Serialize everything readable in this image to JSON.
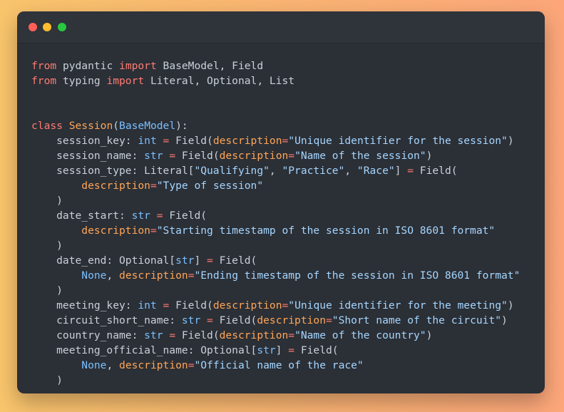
{
  "window": {
    "controls": [
      {
        "name": "close",
        "color": "#ff5f57"
      },
      {
        "name": "minimize",
        "color": "#febc2e"
      },
      {
        "name": "maximize",
        "color": "#28c840"
      }
    ]
  },
  "colors": {
    "keyword": "#ff7b72",
    "class_name": "#ffa657",
    "builtin": "#79c0ff",
    "string": "#a5d6ff",
    "argument": "#ffa657",
    "text": "#c9d1d9"
  },
  "code": {
    "lines": [
      [
        [
          "kw",
          "from"
        ],
        [
          "txt",
          " pydantic "
        ],
        [
          "kw",
          "import"
        ],
        [
          "txt",
          " BaseModel, Field"
        ]
      ],
      [
        [
          "kw",
          "from"
        ],
        [
          "txt",
          " typing "
        ],
        [
          "kw",
          "import"
        ],
        [
          "txt",
          " Literal, Optional, List"
        ]
      ],
      [],
      [],
      [
        [
          "kw",
          "class"
        ],
        [
          "txt",
          " "
        ],
        [
          "cls",
          "Session"
        ],
        [
          "txt",
          "("
        ],
        [
          "bi",
          "BaseModel"
        ],
        [
          "txt",
          "):"
        ]
      ],
      [
        [
          "txt",
          "    session_key: "
        ],
        [
          "bi",
          "int"
        ],
        [
          "txt",
          " "
        ],
        [
          "kw",
          "="
        ],
        [
          "txt",
          " Field("
        ],
        [
          "arg",
          "description"
        ],
        [
          "kw",
          "="
        ],
        [
          "str",
          "\"Unique identifier for the session\""
        ],
        [
          "txt",
          ")"
        ]
      ],
      [
        [
          "txt",
          "    session_name: "
        ],
        [
          "bi",
          "str"
        ],
        [
          "txt",
          " "
        ],
        [
          "kw",
          "="
        ],
        [
          "txt",
          " Field("
        ],
        [
          "arg",
          "description"
        ],
        [
          "kw",
          "="
        ],
        [
          "str",
          "\"Name of the session\""
        ],
        [
          "txt",
          ")"
        ]
      ],
      [
        [
          "txt",
          "    session_type: Literal["
        ],
        [
          "str",
          "\"Qualifying\""
        ],
        [
          "txt",
          ", "
        ],
        [
          "str",
          "\"Practice\""
        ],
        [
          "txt",
          ", "
        ],
        [
          "str",
          "\"Race\""
        ],
        [
          "txt",
          "] "
        ],
        [
          "kw",
          "="
        ],
        [
          "txt",
          " Field("
        ]
      ],
      [
        [
          "txt",
          "        "
        ],
        [
          "arg",
          "description"
        ],
        [
          "kw",
          "="
        ],
        [
          "str",
          "\"Type of session\""
        ]
      ],
      [
        [
          "txt",
          "    )"
        ]
      ],
      [
        [
          "txt",
          "    date_start: "
        ],
        [
          "bi",
          "str"
        ],
        [
          "txt",
          " "
        ],
        [
          "kw",
          "="
        ],
        [
          "txt",
          " Field("
        ]
      ],
      [
        [
          "txt",
          "        "
        ],
        [
          "arg",
          "description"
        ],
        [
          "kw",
          "="
        ],
        [
          "str",
          "\"Starting timestamp of the session in ISO 8601 format\""
        ]
      ],
      [
        [
          "txt",
          "    )"
        ]
      ],
      [
        [
          "txt",
          "    date_end: Optional["
        ],
        [
          "bi",
          "str"
        ],
        [
          "txt",
          "] "
        ],
        [
          "kw",
          "="
        ],
        [
          "txt",
          " Field("
        ]
      ],
      [
        [
          "txt",
          "        "
        ],
        [
          "const",
          "None"
        ],
        [
          "txt",
          ", "
        ],
        [
          "arg",
          "description"
        ],
        [
          "kw",
          "="
        ],
        [
          "str",
          "\"Ending timestamp of the session in ISO 8601 format\""
        ]
      ],
      [
        [
          "txt",
          "    )"
        ]
      ],
      [
        [
          "txt",
          "    meeting_key: "
        ],
        [
          "bi",
          "int"
        ],
        [
          "txt",
          " "
        ],
        [
          "kw",
          "="
        ],
        [
          "txt",
          " Field("
        ],
        [
          "arg",
          "description"
        ],
        [
          "kw",
          "="
        ],
        [
          "str",
          "\"Unique identifier for the meeting\""
        ],
        [
          "txt",
          ")"
        ]
      ],
      [
        [
          "txt",
          "    circuit_short_name: "
        ],
        [
          "bi",
          "str"
        ],
        [
          "txt",
          " "
        ],
        [
          "kw",
          "="
        ],
        [
          "txt",
          " Field("
        ],
        [
          "arg",
          "description"
        ],
        [
          "kw",
          "="
        ],
        [
          "str",
          "\"Short name of the circuit\""
        ],
        [
          "txt",
          ")"
        ]
      ],
      [
        [
          "txt",
          "    country_name: "
        ],
        [
          "bi",
          "str"
        ],
        [
          "txt",
          " "
        ],
        [
          "kw",
          "="
        ],
        [
          "txt",
          " Field("
        ],
        [
          "arg",
          "description"
        ],
        [
          "kw",
          "="
        ],
        [
          "str",
          "\"Name of the country\""
        ],
        [
          "txt",
          ")"
        ]
      ],
      [
        [
          "txt",
          "    meeting_official_name: Optional["
        ],
        [
          "bi",
          "str"
        ],
        [
          "txt",
          "] "
        ],
        [
          "kw",
          "="
        ],
        [
          "txt",
          " Field("
        ]
      ],
      [
        [
          "txt",
          "        "
        ],
        [
          "const",
          "None"
        ],
        [
          "txt",
          ", "
        ],
        [
          "arg",
          "description"
        ],
        [
          "kw",
          "="
        ],
        [
          "str",
          "\"Official name of the race\""
        ]
      ],
      [
        [
          "txt",
          "    )"
        ]
      ]
    ]
  }
}
